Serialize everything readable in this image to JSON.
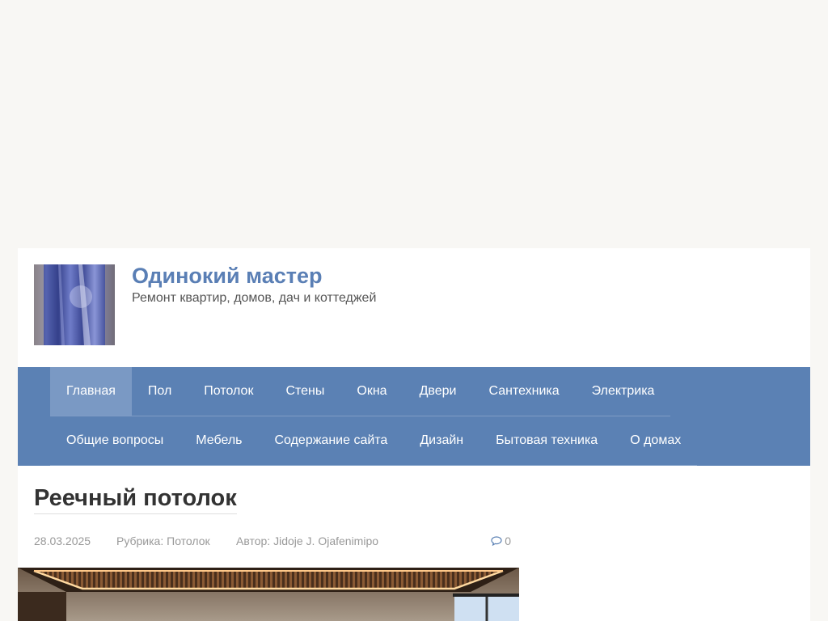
{
  "site": {
    "title": "Одинокий мастер",
    "description": "Ремонт квартир, домов, дач и коттеджей"
  },
  "nav": {
    "row1": [
      {
        "label": "Главная",
        "active": true
      },
      {
        "label": "Пол"
      },
      {
        "label": "Потолок"
      },
      {
        "label": "Стены"
      },
      {
        "label": "Окна"
      },
      {
        "label": "Двери"
      },
      {
        "label": "Сантехника"
      },
      {
        "label": "Электрика"
      }
    ],
    "row2": [
      {
        "label": "Общие вопросы"
      },
      {
        "label": "Мебель"
      },
      {
        "label": "Содержание сайта"
      },
      {
        "label": "Дизайн"
      },
      {
        "label": "Бытовая техника"
      },
      {
        "label": "О домах"
      }
    ]
  },
  "post": {
    "title": "Реечный потолок",
    "date": "28.03.2025",
    "category_prefix": "Рубрика:",
    "category": "Потолок",
    "author_prefix": "Автор:",
    "author": "Jidoje J. Ojafenimipo",
    "comments_count": "0",
    "comments_icon": "comment-icon"
  },
  "colors": {
    "accent": "#5b81b4",
    "title": "#5a7fb5",
    "background": "#f8f7f4"
  }
}
